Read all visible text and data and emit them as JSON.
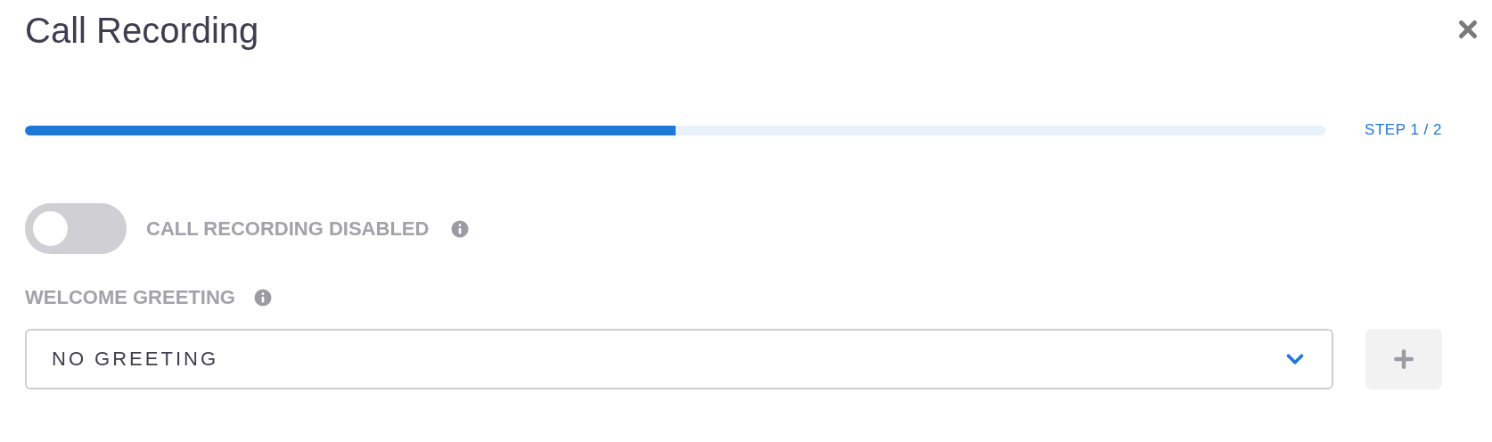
{
  "dialog": {
    "title": "Call Recording"
  },
  "progress": {
    "level": 0.5,
    "step": "STEP 1 / 2"
  },
  "recording_toggle": {
    "label": "CALL RECORDING DISABLED",
    "on": false
  },
  "greeting": {
    "label": "WELCOME GREETING",
    "value": "NO GREETING"
  }
}
